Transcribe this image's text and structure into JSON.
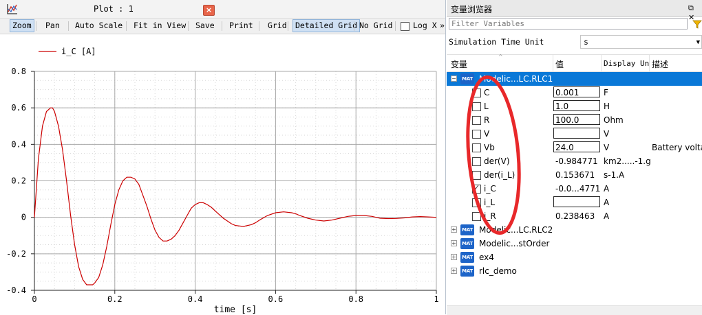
{
  "plot_window": {
    "title": "Plot : 1",
    "close_label": "×",
    "toolbar": [
      {
        "label": "Zoom",
        "active": true
      },
      {
        "label": "Pan",
        "active": false
      },
      {
        "label": "Auto Scale",
        "active": false
      },
      {
        "label": "Fit in View",
        "active": false
      },
      {
        "label": "Save",
        "active": false
      },
      {
        "label": "Print",
        "active": false
      },
      {
        "label": "Grid",
        "active": false
      },
      {
        "label": "Detailed Grid",
        "active": true
      },
      {
        "label": "No Grid",
        "active": false
      },
      {
        "label": "Log X",
        "active": false
      },
      {
        "label": "»",
        "active": false
      }
    ]
  },
  "chart_data": {
    "type": "line",
    "title": "",
    "xlabel": "time [s]",
    "ylabel": "",
    "xlim": [
      0,
      1
    ],
    "ylim": [
      -0.4,
      0.8
    ],
    "x_ticks": [
      "0",
      "0.2",
      "0.4",
      "0.6",
      "0.8",
      "1"
    ],
    "y_ticks": [
      "-0.4",
      "-0.2",
      "0",
      "0.2",
      "0.4",
      "0.6",
      "0.8"
    ],
    "grid": true,
    "legend_position": "top-left",
    "series": [
      {
        "name": "i_C [A]",
        "color": "#cc0000",
        "x": [
          0,
          0.01,
          0.02,
          0.03,
          0.04,
          0.045,
          0.05,
          0.06,
          0.07,
          0.08,
          0.09,
          0.1,
          0.11,
          0.12,
          0.13,
          0.14,
          0.145,
          0.15,
          0.16,
          0.17,
          0.18,
          0.19,
          0.2,
          0.21,
          0.22,
          0.23,
          0.24,
          0.25,
          0.26,
          0.27,
          0.28,
          0.29,
          0.3,
          0.31,
          0.32,
          0.33,
          0.34,
          0.35,
          0.36,
          0.37,
          0.38,
          0.39,
          0.4,
          0.41,
          0.42,
          0.43,
          0.44,
          0.45,
          0.46,
          0.47,
          0.48,
          0.49,
          0.5,
          0.52,
          0.54,
          0.55,
          0.56,
          0.58,
          0.6,
          0.62,
          0.64,
          0.65,
          0.66,
          0.68,
          0.7,
          0.72,
          0.74,
          0.75,
          0.76,
          0.78,
          0.8,
          0.82,
          0.84,
          0.85,
          0.86,
          0.88,
          0.9,
          0.92,
          0.94,
          0.95,
          0.96,
          0.98,
          1.0
        ],
        "y": [
          0,
          0.32,
          0.5,
          0.58,
          0.6,
          0.6,
          0.58,
          0.5,
          0.37,
          0.2,
          0.01,
          -0.15,
          -0.27,
          -0.34,
          -0.37,
          -0.37,
          -0.37,
          -0.36,
          -0.33,
          -0.26,
          -0.16,
          -0.04,
          0.07,
          0.15,
          0.2,
          0.22,
          0.22,
          0.21,
          0.18,
          0.12,
          0.06,
          -0.01,
          -0.07,
          -0.11,
          -0.13,
          -0.13,
          -0.12,
          -0.1,
          -0.07,
          -0.03,
          0.01,
          0.05,
          0.07,
          0.08,
          0.08,
          0.07,
          0.055,
          0.035,
          0.015,
          -0.005,
          -0.02,
          -0.035,
          -0.045,
          -0.05,
          -0.04,
          -0.03,
          -0.015,
          0.01,
          0.025,
          0.03,
          0.025,
          0.02,
          0.01,
          -0.005,
          -0.015,
          -0.02,
          -0.015,
          -0.01,
          -0.005,
          0.005,
          0.01,
          0.01,
          0.005,
          0.0,
          -0.005,
          -0.007,
          -0.006,
          -0.003,
          0.002,
          0.003,
          0.004,
          0.002,
          0.0
        ]
      }
    ]
  },
  "browser": {
    "title": "变量浏览器",
    "float_icon": "⧉ ✕",
    "filter_placeholder": "Filter Variables",
    "time_unit_label": "Simulation Time Unit",
    "time_unit_value": "s",
    "columns": [
      "变量",
      "值",
      "Display Un:",
      "描述"
    ],
    "tree": [
      {
        "name": "Modelic...LC.RLC1",
        "expanded": true,
        "selected": true,
        "children": [
          {
            "name": "C",
            "value": "0.001",
            "editable": true,
            "unit": "F",
            "desc": "",
            "checked": false
          },
          {
            "name": "L",
            "value": "1.0",
            "editable": true,
            "unit": "H",
            "desc": "",
            "checked": false
          },
          {
            "name": "R",
            "value": "100.0",
            "editable": true,
            "unit": "Ohm",
            "desc": "",
            "checked": false
          },
          {
            "name": "V",
            "value": "",
            "editable": true,
            "unit": "V",
            "desc": "",
            "checked": false
          },
          {
            "name": "Vb",
            "value": "24.0",
            "editable": true,
            "unit": "V",
            "desc": "Battery volta",
            "checked": false
          },
          {
            "name": "der(V)",
            "value": "-0.984771",
            "editable": false,
            "unit": "km2.....-1.g",
            "desc": "",
            "checked": false
          },
          {
            "name": "der(i_L)",
            "value": "0.153671",
            "editable": false,
            "unit": "s-1.A",
            "desc": "",
            "checked": false
          },
          {
            "name": "i_C",
            "value": "-0.0...4771",
            "editable": false,
            "unit": "A",
            "desc": "",
            "checked": true
          },
          {
            "name": "i_L",
            "value": "",
            "editable": true,
            "unit": "A",
            "desc": "",
            "checked": false
          },
          {
            "name": "i_R",
            "value": "0.238463",
            "editable": false,
            "unit": "A",
            "desc": "",
            "checked": false
          }
        ]
      },
      {
        "name": "Modelic...LC.RLC2",
        "expanded": false,
        "selected": false,
        "children": []
      },
      {
        "name": "Modelic...stOrder",
        "expanded": false,
        "selected": false,
        "children": []
      },
      {
        "name": "ex4",
        "expanded": false,
        "selected": false,
        "children": []
      },
      {
        "name": "rlc_demo",
        "expanded": false,
        "selected": false,
        "children": []
      }
    ],
    "mat_badge": "MAT",
    "annotation_color": "#e8282a"
  }
}
